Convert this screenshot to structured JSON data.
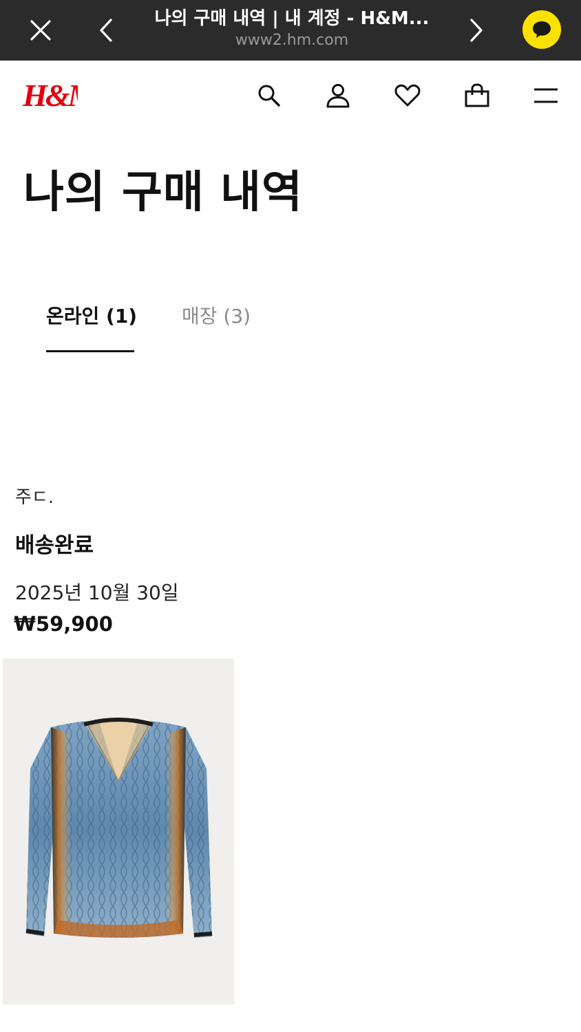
{
  "browser": {
    "title": "나의 구매 내역 | 내 계정 - H&M...",
    "url": "www2.hm.com",
    "accent": "#ffe100"
  },
  "header": {
    "logo_text": "H&M",
    "logo_color": "#e50010",
    "icons": [
      "search-icon",
      "account-icon",
      "heart-icon",
      "bag-icon",
      "menu-icon"
    ]
  },
  "page": {
    "title": "나의 구매 내역"
  },
  "tabs": [
    {
      "label": "온라인 (1)",
      "active": true
    },
    {
      "label": "매장 (3)",
      "active": false
    }
  ],
  "order": {
    "label": "주ㄷ.",
    "status": "배송완료",
    "date": "2025년 10월 30일",
    "price": "₩59,900"
  }
}
